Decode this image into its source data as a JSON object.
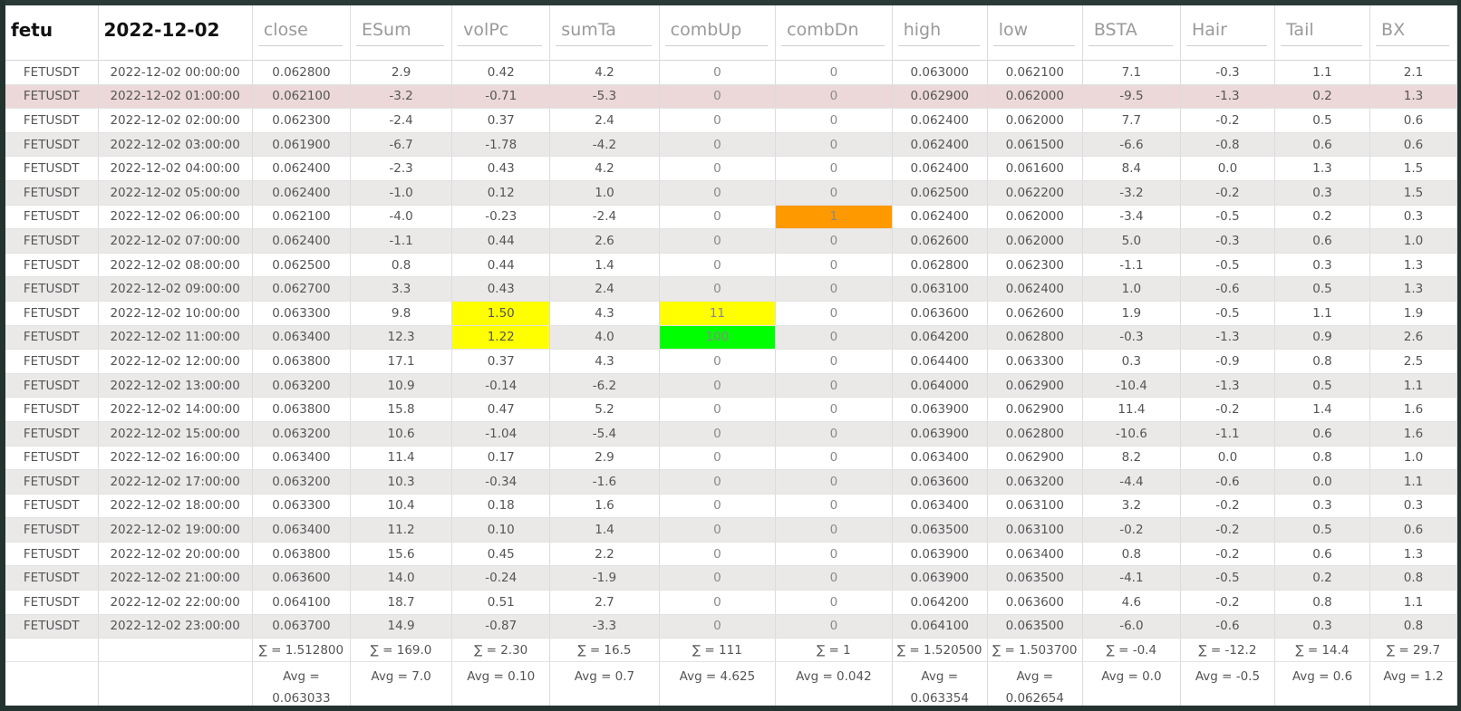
{
  "header": {
    "symbol": "fetu",
    "date": "2022-12-02",
    "columns": [
      "close",
      "ESum",
      "volPc",
      "sumTa",
      "combUp",
      "combDn",
      "high",
      "low",
      "BSTA",
      "Hair",
      "Tail",
      "BX"
    ]
  },
  "colors": {
    "yellow": "#ffff00",
    "green": "#00ff00",
    "orange": "#ff9900",
    "row_highlight": "#ecd8d9"
  },
  "rows": [
    [
      "FETUSDT",
      "2022-12-02 00:00:00",
      "0.062800",
      "2.9",
      "0.42",
      "4.2",
      "0",
      "0",
      "0.063000",
      "0.062100",
      "7.1",
      "-0.3",
      "1.1",
      "2.1"
    ],
    [
      "FETUSDT",
      "2022-12-02 01:00:00",
      "0.062100",
      "-3.2",
      "-0.71",
      "-5.3",
      "0",
      "0",
      "0.062900",
      "0.062000",
      "-9.5",
      "-1.3",
      "0.2",
      "1.3"
    ],
    [
      "FETUSDT",
      "2022-12-02 02:00:00",
      "0.062300",
      "-2.4",
      "0.37",
      "2.4",
      "0",
      "0",
      "0.062400",
      "0.062000",
      "7.7",
      "-0.2",
      "0.5",
      "0.6"
    ],
    [
      "FETUSDT",
      "2022-12-02 03:00:00",
      "0.061900",
      "-6.7",
      "-1.78",
      "-4.2",
      "0",
      "0",
      "0.062400",
      "0.061500",
      "-6.6",
      "-0.8",
      "0.6",
      "0.6"
    ],
    [
      "FETUSDT",
      "2022-12-02 04:00:00",
      "0.062400",
      "-2.3",
      "0.43",
      "4.2",
      "0",
      "0",
      "0.062400",
      "0.061600",
      "8.4",
      "0.0",
      "1.3",
      "1.5"
    ],
    [
      "FETUSDT",
      "2022-12-02 05:00:00",
      "0.062400",
      "-1.0",
      "0.12",
      "1.0",
      "0",
      "0",
      "0.062500",
      "0.062200",
      "-3.2",
      "-0.2",
      "0.3",
      "1.5"
    ],
    [
      "FETUSDT",
      "2022-12-02 06:00:00",
      "0.062100",
      "-4.0",
      "-0.23",
      "-2.4",
      "0",
      "1",
      "0.062400",
      "0.062000",
      "-3.4",
      "-0.5",
      "0.2",
      "0.3"
    ],
    [
      "FETUSDT",
      "2022-12-02 07:00:00",
      "0.062400",
      "-1.1",
      "0.44",
      "2.6",
      "0",
      "0",
      "0.062600",
      "0.062000",
      "5.0",
      "-0.3",
      "0.6",
      "1.0"
    ],
    [
      "FETUSDT",
      "2022-12-02 08:00:00",
      "0.062500",
      "0.8",
      "0.44",
      "1.4",
      "0",
      "0",
      "0.062800",
      "0.062300",
      "-1.1",
      "-0.5",
      "0.3",
      "1.3"
    ],
    [
      "FETUSDT",
      "2022-12-02 09:00:00",
      "0.062700",
      "3.3",
      "0.43",
      "2.4",
      "0",
      "0",
      "0.063100",
      "0.062400",
      "1.0",
      "-0.6",
      "0.5",
      "1.3"
    ],
    [
      "FETUSDT",
      "2022-12-02 10:00:00",
      "0.063300",
      "9.8",
      "1.50",
      "4.3",
      "11",
      "0",
      "0.063600",
      "0.062600",
      "1.9",
      "-0.5",
      "1.1",
      "1.9"
    ],
    [
      "FETUSDT",
      "2022-12-02 11:00:00",
      "0.063400",
      "12.3",
      "1.22",
      "4.0",
      "100",
      "0",
      "0.064200",
      "0.062800",
      "-0.3",
      "-1.3",
      "0.9",
      "2.6"
    ],
    [
      "FETUSDT",
      "2022-12-02 12:00:00",
      "0.063800",
      "17.1",
      "0.37",
      "4.3",
      "0",
      "0",
      "0.064400",
      "0.063300",
      "0.3",
      "-0.9",
      "0.8",
      "2.5"
    ],
    [
      "FETUSDT",
      "2022-12-02 13:00:00",
      "0.063200",
      "10.9",
      "-0.14",
      "-6.2",
      "0",
      "0",
      "0.064000",
      "0.062900",
      "-10.4",
      "-1.3",
      "0.5",
      "1.1"
    ],
    [
      "FETUSDT",
      "2022-12-02 14:00:00",
      "0.063800",
      "15.8",
      "0.47",
      "5.2",
      "0",
      "0",
      "0.063900",
      "0.062900",
      "11.4",
      "-0.2",
      "1.4",
      "1.6"
    ],
    [
      "FETUSDT",
      "2022-12-02 15:00:00",
      "0.063200",
      "10.6",
      "-1.04",
      "-5.4",
      "0",
      "0",
      "0.063900",
      "0.062800",
      "-10.6",
      "-1.1",
      "0.6",
      "1.6"
    ],
    [
      "FETUSDT",
      "2022-12-02 16:00:00",
      "0.063400",
      "11.4",
      "0.17",
      "2.9",
      "0",
      "0",
      "0.063400",
      "0.062900",
      "8.2",
      "0.0",
      "0.8",
      "1.0"
    ],
    [
      "FETUSDT",
      "2022-12-02 17:00:00",
      "0.063200",
      "10.3",
      "-0.34",
      "-1.6",
      "0",
      "0",
      "0.063600",
      "0.063200",
      "-4.4",
      "-0.6",
      "0.0",
      "1.1"
    ],
    [
      "FETUSDT",
      "2022-12-02 18:00:00",
      "0.063300",
      "10.4",
      "0.18",
      "1.6",
      "0",
      "0",
      "0.063400",
      "0.063100",
      "3.2",
      "-0.2",
      "0.3",
      "0.3"
    ],
    [
      "FETUSDT",
      "2022-12-02 19:00:00",
      "0.063400",
      "11.2",
      "0.10",
      "1.4",
      "0",
      "0",
      "0.063500",
      "0.063100",
      "-0.2",
      "-0.2",
      "0.5",
      "0.6"
    ],
    [
      "FETUSDT",
      "2022-12-02 20:00:00",
      "0.063800",
      "15.6",
      "0.45",
      "2.2",
      "0",
      "0",
      "0.063900",
      "0.063400",
      "0.8",
      "-0.2",
      "0.6",
      "1.3"
    ],
    [
      "FETUSDT",
      "2022-12-02 21:00:00",
      "0.063600",
      "14.0",
      "-0.24",
      "-1.9",
      "0",
      "0",
      "0.063900",
      "0.063500",
      "-4.1",
      "-0.5",
      "0.2",
      "0.8"
    ],
    [
      "FETUSDT",
      "2022-12-02 22:00:00",
      "0.064100",
      "18.7",
      "0.51",
      "2.7",
      "0",
      "0",
      "0.064200",
      "0.063600",
      "4.6",
      "-0.2",
      "0.8",
      "1.1"
    ],
    [
      "FETUSDT",
      "2022-12-02 23:00:00",
      "0.063700",
      "14.9",
      "-0.87",
      "-3.3",
      "0",
      "0",
      "0.064100",
      "0.063500",
      "-6.0",
      "-0.6",
      "0.3",
      "0.8"
    ]
  ],
  "highlights": [
    {
      "row": 1,
      "col": "all",
      "color": "row_highlight"
    },
    {
      "row": 6,
      "col": 7,
      "color": "orange"
    },
    {
      "row": 10,
      "col": 4,
      "color": "yellow"
    },
    {
      "row": 10,
      "col": 6,
      "color": "yellow"
    },
    {
      "row": 11,
      "col": 4,
      "color": "yellow"
    },
    {
      "row": 11,
      "col": 6,
      "color": "green"
    }
  ],
  "sums": [
    "",
    "",
    "∑ = 1.512800",
    "∑ = 169.0",
    "∑ = 2.30",
    "∑ = 16.5",
    "∑ = 111",
    "∑ = 1",
    "∑ = 1.520500",
    "∑ = 1.503700",
    "∑ = -0.4",
    "∑ = -12.2",
    "∑ = 14.4",
    "∑ = 29.7"
  ],
  "avgs": [
    "",
    "",
    "Avg = 0.063033",
    "Avg = 7.0",
    "Avg = 0.10",
    "Avg = 0.7",
    "Avg = 4.625",
    "Avg = 0.042",
    "Avg = 0.063354",
    "Avg = 0.062654",
    "Avg = 0.0",
    "Avg = -0.5",
    "Avg = 0.6",
    "Avg = 1.2"
  ]
}
